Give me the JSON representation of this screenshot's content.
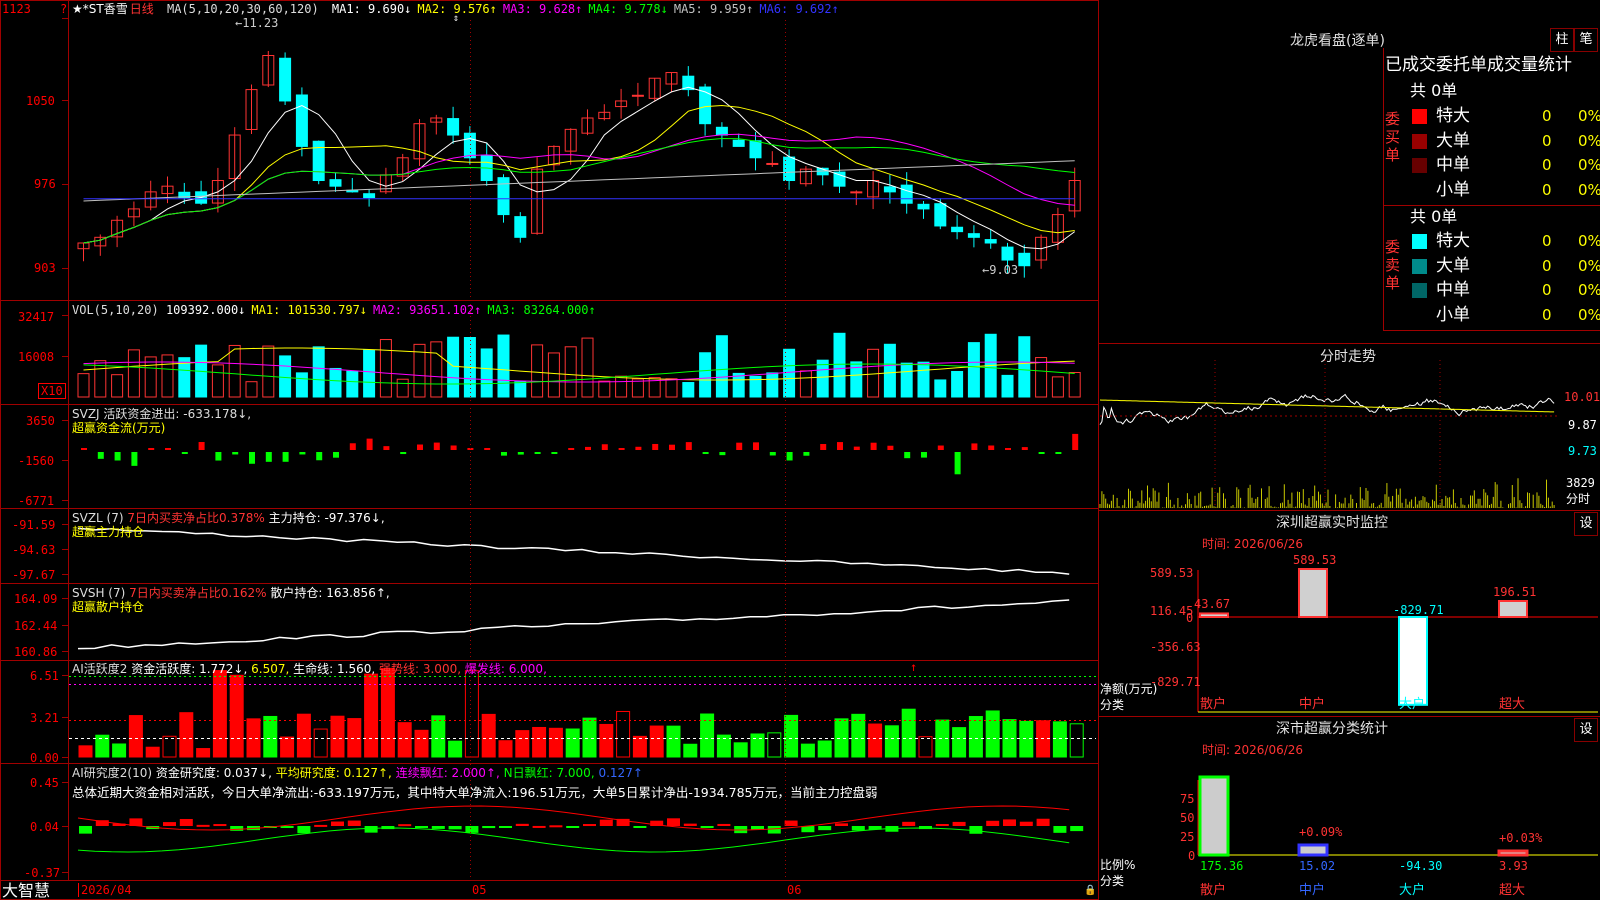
{
  "stock": {
    "name": "★*ST香雪",
    "period": "日线",
    "peak_label": "←11.23",
    "low_label": "←9.03"
  },
  "ma_line": {
    "prefix": "MA(5,10,20,30,60,120)",
    "items": [
      {
        "label": "MA1: 9.690↓",
        "color": "#ffffff"
      },
      {
        "label": "MA2: 9.576↑",
        "color": "#ffff00"
      },
      {
        "label": "MA3: 9.628↑",
        "color": "#ff00ff"
      },
      {
        "label": "MA4: 9.778↓",
        "color": "#00ff00"
      },
      {
        "label": "MA5: 9.959↑",
        "color": "#c0c0c0"
      },
      {
        "label": "MA6: 9.692↑",
        "color": "#3333ff"
      }
    ]
  },
  "price_axis": [
    "1123",
    "1050",
    "976",
    "903"
  ],
  "vol_line": {
    "prefix": "VOL(5,10,20)",
    "value": "109392.000↓",
    "items": [
      {
        "label": "MA1: 101530.797↓",
        "color": "#ffff00"
      },
      {
        "label": "MA2: 93651.102↑",
        "color": "#ff00ff"
      },
      {
        "label": "MA3: 83264.000↑",
        "color": "#00ff00"
      }
    ],
    "axis": [
      "32417",
      "16008"
    ],
    "unit": "X10"
  },
  "svzj": {
    "title": "SVZJ  活跃资金进出: -633.178↓,",
    "subtitle": "超赢资金流(万元)",
    "axis": [
      "3650",
      "-1560",
      "-6771"
    ]
  },
  "svzl": {
    "title": "SVZL (7)",
    "ratio": "7日内买卖净占比0.378%",
    "hold": "主力持仓: -97.376↓,",
    "subtitle": "超赢主力持仓",
    "axis": [
      "-91.59",
      "-94.63",
      "-97.67"
    ]
  },
  "svsh": {
    "title": "SVSH (7)",
    "ratio": "7日内买卖净占比0.162%",
    "hold": "散户持仓: 163.856↑,",
    "subtitle": "超赢散户持仓",
    "axis": [
      "164.09",
      "162.44",
      "160.86"
    ]
  },
  "ai_active": {
    "title": "AI活跃度2",
    "activity": "资金活跃度: 1.772↓,",
    "v2": "6.507,",
    "life": "生命线: 1.560,",
    "strong": "强势线: 3.000,",
    "burst": "爆发线: 6.000,",
    "axis": [
      "6.51",
      "3.21",
      "0.00"
    ]
  },
  "ai_research": {
    "title": "AI研究度2(10)",
    "research": "资金研究度: 0.037↓,",
    "avg": "平均研究度: 0.127↑,",
    "cont": "连续飘红: 2.000↑,",
    "nday": "N日飘红: 7.000,",
    "tail": "0.127↑",
    "summary": "总体近期大资金相对活跃，今日大单净流出:-633.197万元，其中特大单净流入:196.51万元，大单5日累计净出-1934.785万元，当前主力控盘弱",
    "axis": [
      "0.45",
      "0.04",
      "-0.37"
    ]
  },
  "x_axis": {
    "start": "2026/04",
    "m5": "05",
    "m6": "06"
  },
  "brand": "大智慧",
  "dragon": {
    "title": "龙虎看盘(逐单)",
    "btn_zhu": "柱",
    "btn_bi": "笔",
    "heading": "已成交委托单成交量统计",
    "buy": {
      "side": "委买单",
      "total": "共 0单",
      "rows": [
        {
          "label": "特大",
          "count": "0",
          "pct": "0%",
          "color": "#ff0000"
        },
        {
          "label": "大单",
          "count": "0",
          "pct": "0%",
          "color": "#990000"
        },
        {
          "label": "中单",
          "count": "0",
          "pct": "0%",
          "color": "#660000"
        },
        {
          "label": "小单",
          "count": "0",
          "pct": "0%",
          "color": ""
        }
      ]
    },
    "sell": {
      "side": "委卖单",
      "total": "共 0单",
      "rows": [
        {
          "label": "特大",
          "count": "0",
          "pct": "0%",
          "color": "#00ffff"
        },
        {
          "label": "大单",
          "count": "0",
          "pct": "0%",
          "color": "#008b8b"
        },
        {
          "label": "中单",
          "count": "0",
          "pct": "0%",
          "color": "#006666"
        },
        {
          "label": "小单",
          "count": "0",
          "pct": "0%",
          "color": ""
        }
      ]
    }
  },
  "intraday": {
    "title": "分时走势",
    "axis": [
      "10.01",
      "9.87",
      "9.73"
    ],
    "vol_top": "3829",
    "vol_unit": "分时"
  },
  "sz_monitor": {
    "title": "深圳超赢实时监控",
    "btn": "设",
    "time": "时间: 2026/06/26",
    "axis": [
      "589.53",
      "116.45",
      "0",
      "-356.63",
      "-829.71"
    ],
    "ylabel": "净额(万元)",
    "xlabel": "分类",
    "cats": [
      "散户",
      "中户",
      "大户",
      "超大"
    ],
    "values": [
      43.67,
      589.53,
      -829.71,
      196.51
    ],
    "labels": [
      "43.67",
      "589.53",
      "-829.71",
      "196.51"
    ]
  },
  "sz_class": {
    "title": "深市超赢分类统计",
    "btn": "设",
    "time": "时间: 2026/06/26",
    "axis": [
      "75",
      "50",
      "25",
      "0"
    ],
    "ylabel": "比例%",
    "xlabel": "分类",
    "cats": [
      "散户",
      "中户",
      "大户",
      "超大"
    ],
    "pct_labels": [
      "",
      "+0.09%",
      "",
      "+0.03%"
    ],
    "values": [
      "175.36",
      "15.02",
      "-94.30",
      "3.93"
    ]
  }
}
